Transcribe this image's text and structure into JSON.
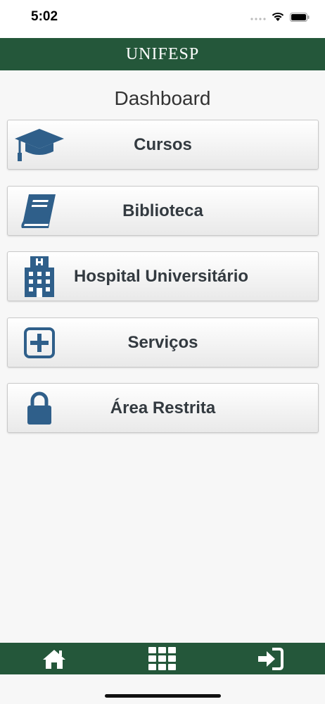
{
  "status_bar": {
    "time": "5:02"
  },
  "header": {
    "title": "UNIFESP"
  },
  "page": {
    "title": "Dashboard"
  },
  "menu": [
    {
      "label": "Cursos",
      "icon": "graduation-cap-icon"
    },
    {
      "label": "Biblioteca",
      "icon": "book-icon"
    },
    {
      "label": "Hospital Universitário",
      "icon": "hospital-icon"
    },
    {
      "label": "Serviços",
      "icon": "plus-square-icon"
    },
    {
      "label": "Área Restrita",
      "icon": "lock-icon"
    }
  ],
  "tabbar": {
    "items": [
      {
        "icon": "home-icon"
      },
      {
        "icon": "grid-icon"
      },
      {
        "icon": "sign-in-icon"
      }
    ]
  },
  "colors": {
    "brand_green": "#24573a",
    "icon_blue": "#2f5f8a",
    "label_text": "#333a40"
  }
}
